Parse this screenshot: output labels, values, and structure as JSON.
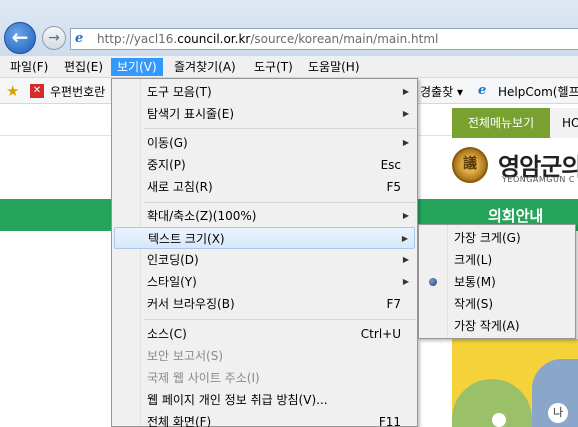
{
  "browser": {
    "url_prefix": "http://yacl16.",
    "url_domain": "council.or.kr",
    "url_path": "/source/korean/main/main.html"
  },
  "menubar": {
    "items": [
      {
        "label": "파일(F)"
      },
      {
        "label": "편집(E)"
      },
      {
        "label": "보기(V)"
      },
      {
        "label": "즐겨찾기(A)"
      },
      {
        "label": "도구(T)"
      },
      {
        "label": "도움말(H)"
      }
    ]
  },
  "favorites": {
    "item1": "우편번호란",
    "item2": "경출찾",
    "item3": "HelpCom(헬프"
  },
  "page": {
    "tab_green": "전체메뉴보기",
    "tab_grey": "HO",
    "seal_char": "議",
    "site_title": "영암군의",
    "site_sub": "YEONGAMGUN C",
    "nav_label": "의회안내",
    "map_pin": "나"
  },
  "view_menu": {
    "items": [
      {
        "label": "도구 모음(T)",
        "shortcut": "",
        "submenu": true
      },
      {
        "label": "탐색기 표시줄(E)",
        "shortcut": "",
        "submenu": true
      },
      {
        "label": "이동(G)",
        "shortcut": "",
        "submenu": true
      },
      {
        "label": "중지(P)",
        "shortcut": "Esc",
        "submenu": false
      },
      {
        "label": "새로 고침(R)",
        "shortcut": "F5",
        "submenu": false
      },
      {
        "label": "확대/축소(Z)(100%)",
        "shortcut": "",
        "submenu": true
      },
      {
        "label": "텍스트 크기(X)",
        "shortcut": "",
        "submenu": true
      },
      {
        "label": "인코딩(D)",
        "shortcut": "",
        "submenu": true
      },
      {
        "label": "스타일(Y)",
        "shortcut": "",
        "submenu": true
      },
      {
        "label": "커서 브라우징(B)",
        "shortcut": "F7",
        "submenu": false
      },
      {
        "label": "소스(C)",
        "shortcut": "Ctrl+U",
        "submenu": false
      },
      {
        "label": "보안 보고서(S)",
        "shortcut": "",
        "submenu": false
      },
      {
        "label": "국제 웹 사이트 주소(I)",
        "shortcut": "",
        "submenu": false
      },
      {
        "label": "웹 페이지 개인 정보 취급 방침(V)...",
        "shortcut": "",
        "submenu": false
      },
      {
        "label": "전체 화면(F)",
        "shortcut": "F11",
        "submenu": false
      }
    ]
  },
  "text_size_submenu": {
    "items": [
      {
        "label": "가장 크게(G)"
      },
      {
        "label": "크게(L)"
      },
      {
        "label": "보통(M)",
        "selected": true
      },
      {
        "label": "작게(S)"
      },
      {
        "label": "가장 작게(A)"
      }
    ]
  }
}
